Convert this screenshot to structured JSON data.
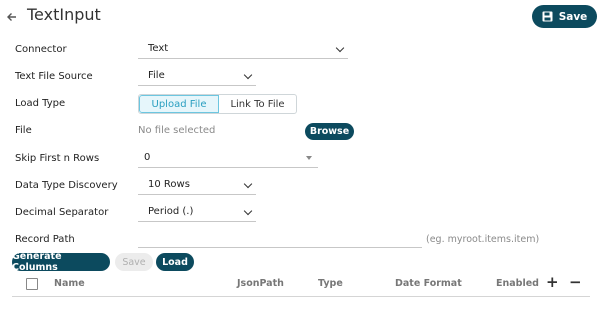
{
  "header": {
    "title": "TextInput",
    "save_label": "Save"
  },
  "form": {
    "connector": {
      "label": "Connector",
      "value": "Text"
    },
    "text_file_source": {
      "label": "Text File Source",
      "value": "File"
    },
    "load_type": {
      "label": "Load Type",
      "options": [
        "Upload File",
        "Link To File"
      ],
      "selected": "Upload File"
    },
    "file": {
      "label": "File",
      "value": "No file selected",
      "browse_label": "Browse"
    },
    "skip_rows": {
      "label": "Skip First n Rows",
      "value": "0"
    },
    "data_type_discovery": {
      "label": "Data Type Discovery",
      "value": "10 Rows"
    },
    "decimal_separator": {
      "label": "Decimal Separator",
      "value": "Period (.)"
    },
    "record_path": {
      "label": "Record Path",
      "value": "",
      "hint": "(eg. myroot.items.item)"
    }
  },
  "actions": {
    "generate_columns": "Generate Columns",
    "save": "Save",
    "load": "Load"
  },
  "table": {
    "columns": [
      "Name",
      "JsonPath",
      "Type",
      "Date Format",
      "Enabled"
    ],
    "add_symbol": "+",
    "remove_symbol": "−"
  },
  "colors": {
    "accent": "#0c4a5e",
    "toggle_active_bg": "#e6f6fb",
    "toggle_active_text": "#2a9fc0"
  }
}
